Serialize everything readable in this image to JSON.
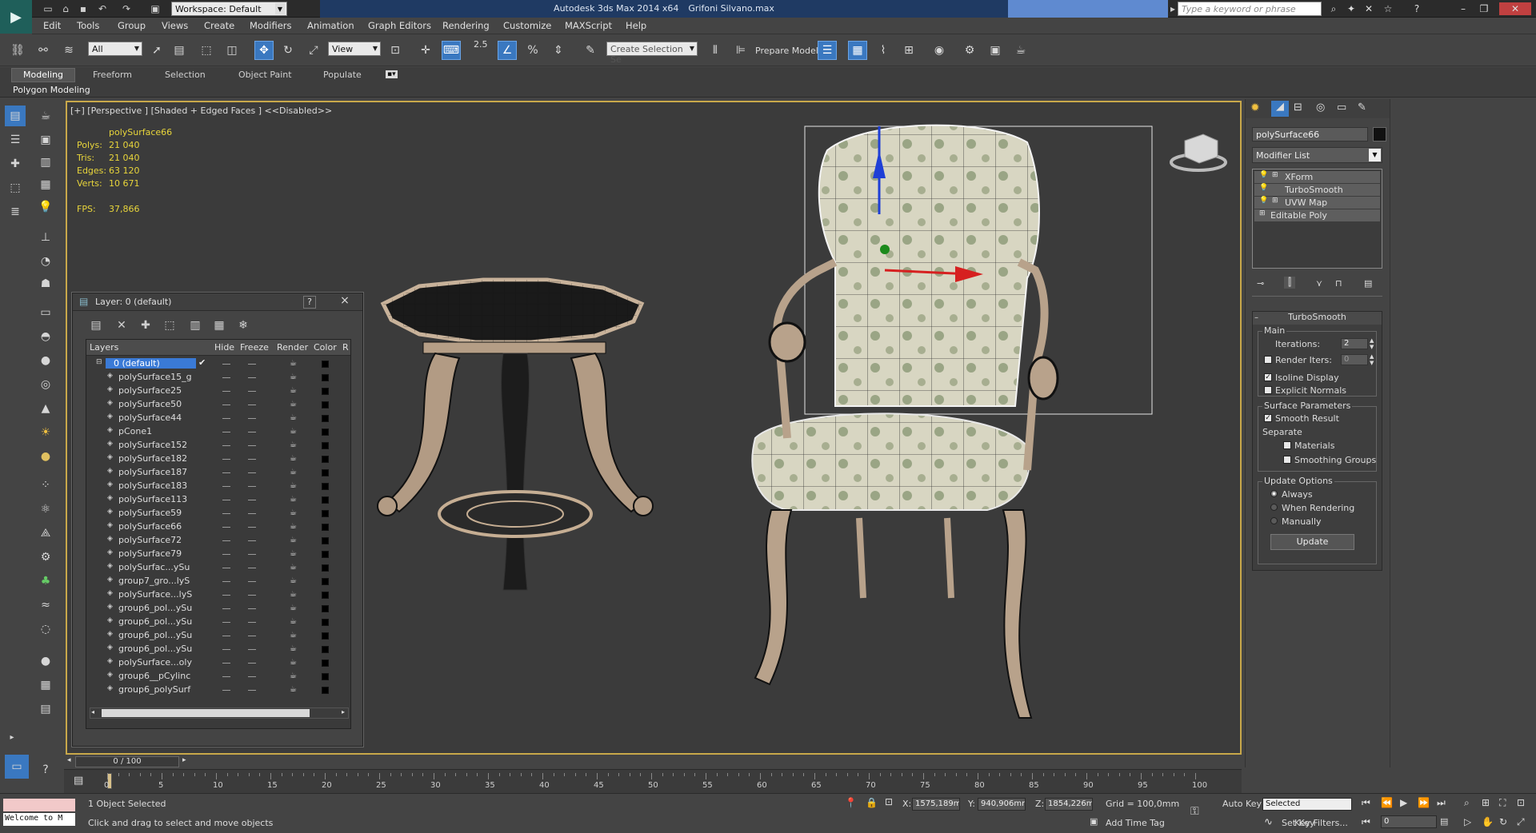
{
  "app": {
    "title": "Autodesk 3ds Max  2014 x64",
    "file": "Grifoni Silvano.max",
    "workspace": "Workspace: Default",
    "search_placeholder": "Type a keyword or phrase"
  },
  "menu": [
    "Edit",
    "Tools",
    "Group",
    "Views",
    "Create",
    "Modifiers",
    "Animation",
    "Graph Editors",
    "Rendering",
    "Customize",
    "MAXScript",
    "Help"
  ],
  "toolbar": {
    "filter": "All",
    "refcoord": "View",
    "snap_label": "2.5",
    "selection_set": "Create Selection Se",
    "prepare_model": "Prepare Model"
  },
  "ribbon": {
    "tabs": [
      "Modeling",
      "Freeform",
      "Selection",
      "Object Paint",
      "Populate"
    ],
    "active": "Modeling",
    "panel": "Polygon Modeling"
  },
  "viewport": {
    "label": "[+] [Perspective ] [Shaded + Edged Faces ]  <<Disabled>>",
    "object": "polySurface66",
    "stats": [
      {
        "k": "Polys:",
        "v": "21 040"
      },
      {
        "k": "Tris:",
        "v": "21 040"
      },
      {
        "k": "Edges:",
        "v": "63 120"
      },
      {
        "k": "Verts:",
        "v": "10 671"
      }
    ],
    "fps_label": "FPS:",
    "fps": "37,866"
  },
  "layer_dialog": {
    "title": "Layer: 0 (default)",
    "help": "?",
    "close": "×",
    "columns": [
      "Layers",
      "Hide",
      "Freeze",
      "Render",
      "Color",
      "R"
    ],
    "rows": [
      "0 (default)",
      "polySurface15_g",
      "polySurface25",
      "polySurface50",
      "polySurface44",
      "pCone1",
      "polySurface152",
      "polySurface182",
      "polySurface187",
      "polySurface183",
      "polySurface113",
      "polySurface59",
      "polySurface66",
      "polySurface72",
      "polySurface79",
      "polySurfac...ySu",
      "group7_gro...lyS",
      "polySurface...lyS",
      "group6_pol...ySu",
      "group6_pol...ySu",
      "group6_pol...ySu",
      "group6_pol...ySu",
      "polySurface...oly",
      "group6__pCylinc",
      "group6_polySurf"
    ]
  },
  "command_panel": {
    "object_name": "polySurface66",
    "modifier_list": "Modifier List",
    "stack": [
      "XForm",
      "TurboSmooth",
      "UVW Map",
      "Editable Poly"
    ],
    "rollout": {
      "title": "TurboSmooth",
      "main": "Main",
      "iterations_label": "Iterations:",
      "iterations": "2",
      "render_iters_label": "Render Iters:",
      "render_iters": "0",
      "isoline": "Isoline Display",
      "explicit_normals": "Explicit Normals",
      "surface_params": "Surface Parameters",
      "smooth_result": "Smooth Result",
      "separate": "Separate",
      "materials": "Materials",
      "smoothing_groups": "Smoothing Groups",
      "update_options": "Update Options",
      "always": "Always",
      "when_rendering": "When Rendering",
      "manually": "Manually",
      "update": "Update"
    }
  },
  "timeline": {
    "frame": "0 / 100",
    "ticks": [
      "0",
      "5",
      "10",
      "15",
      "20",
      "25",
      "30",
      "35",
      "40",
      "45",
      "50",
      "55",
      "60",
      "65",
      "70",
      "75",
      "80",
      "85",
      "90",
      "95",
      "100"
    ]
  },
  "status": {
    "welcome": "Welcome to M",
    "selected": "1 Object Selected",
    "prompt": "Click and drag to select and move objects",
    "x_label": "X:",
    "x": "1575,189m",
    "y_label": "Y:",
    "y": "940,906mr",
    "z_label": "Z:",
    "z": "1854,226m",
    "grid": "Grid = 100,0mm",
    "add_time_tag": "Add Time Tag",
    "auto_key": "Auto Key",
    "set_key": "Set Key",
    "key_mode": "Selected",
    "key_filters": "Key Filters...",
    "current_frame": "0"
  }
}
